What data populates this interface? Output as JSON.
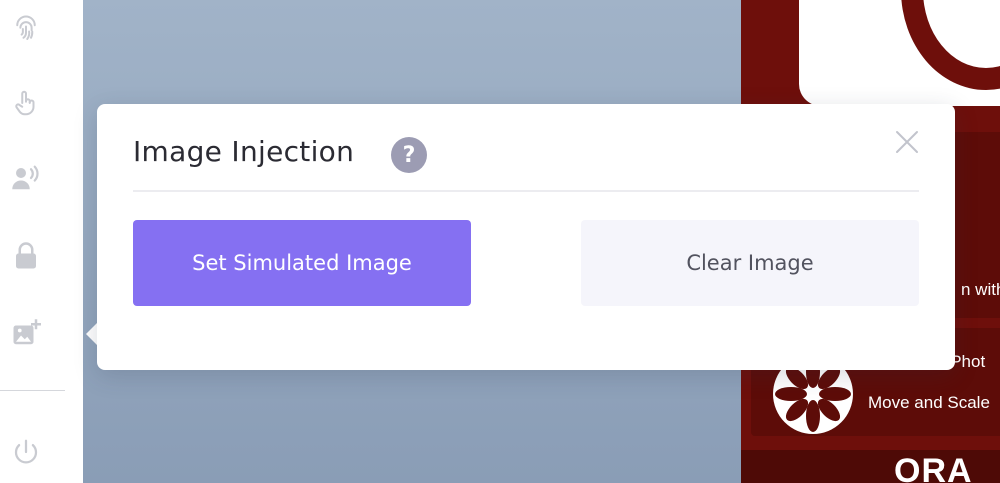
{
  "sidebar": {
    "icons": [
      "fingerprint-icon",
      "touch-icon",
      "voice-icon",
      "lock-icon",
      "image-add-icon",
      "power-icon"
    ]
  },
  "popover": {
    "title": "Image Injection",
    "help_label": "?",
    "primary_button": "Set Simulated Image",
    "secondary_button": "Clear Image"
  },
  "device": {
    "text_line_1": "n with",
    "text_line_2": "Scan from Phot",
    "text_line_3": "Move and Scale",
    "bottom_text": "ORA"
  },
  "colors": {
    "accent": "#8570f2",
    "device_brand": "#6e0f0b",
    "backdrop": "#95a8bf"
  }
}
